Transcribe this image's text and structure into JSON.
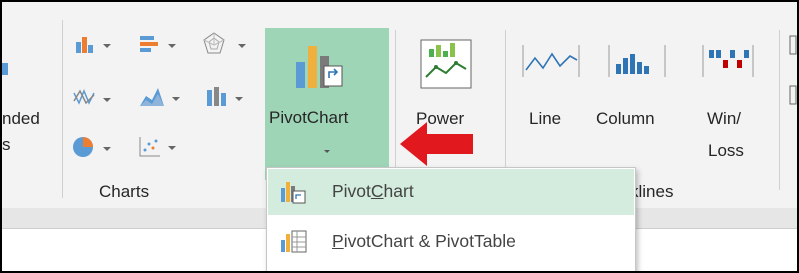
{
  "ribbon": {
    "recommended_fragment_line1": "nded",
    "recommended_fragment_line2": "s",
    "charts_group_label": "Charts",
    "pivotchart_label": "PivotChart",
    "power_label": "Power",
    "sparklines_group_label_fragment": "klines",
    "sparkline_line_label": "Line",
    "sparkline_column_label": "Column",
    "sparkline_winloss_line1": "Win/",
    "sparkline_winloss_line2": "Loss"
  },
  "dropdown": {
    "items": [
      {
        "label": "PivotChart",
        "underline_char": "C",
        "highlighted": true,
        "icon": "pivotchart-icon"
      },
      {
        "label": "PivotChart & PivotTable",
        "underline_char": "P",
        "highlighted": false,
        "icon": "pivotchart-pivottable-icon"
      }
    ]
  },
  "colors": {
    "accent_green": "#9fd5b7",
    "menu_highlight": "#d3ecdd",
    "arrow_red": "#e1191e"
  },
  "annotation": {
    "type": "red-arrow",
    "points_to": "pivotchart-button"
  }
}
